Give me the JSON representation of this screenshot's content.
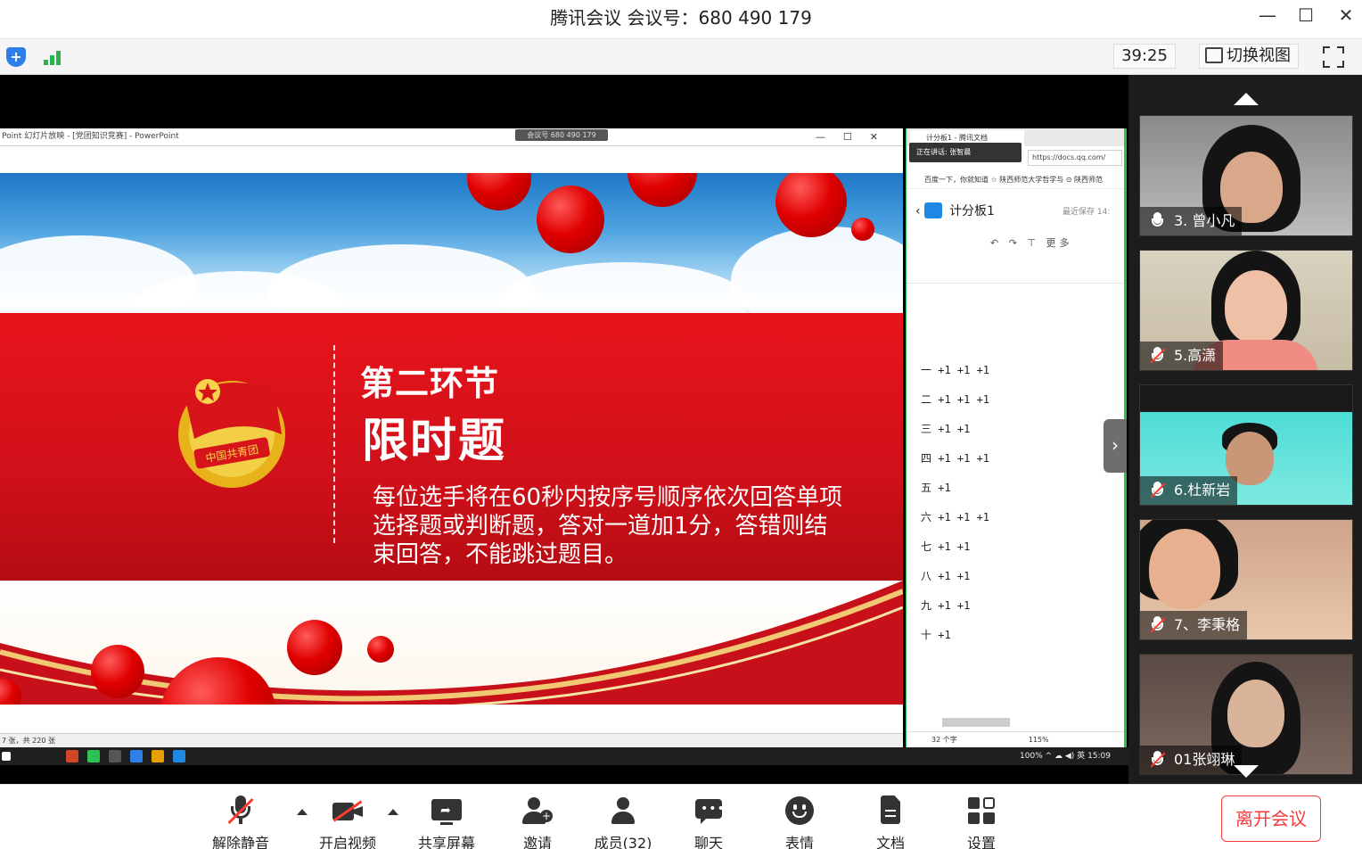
{
  "window": {
    "title": "腾讯会议 会议号：680 490 179",
    "controls": [
      "—",
      "☐",
      "✕"
    ]
  },
  "toolbar": {
    "timer": "39:25",
    "switch_view": "切换视图"
  },
  "share": {
    "ppt": {
      "window_title": "Point 幻灯片放映 - [党团知识竞赛] - PowerPoint",
      "meeting_badge": "会议号 680 490 179",
      "slide_status": "7 张，共 220 张",
      "slide": {
        "section": "第二环节",
        "subsection": "限时题",
        "description": "每位选手将在60秒内按序号顺序依次回答单项选择题或判断题，答对一道加1分，答错则结束回答，不能跳过题目。"
      }
    },
    "docs": {
      "tab_title": "计分板1 - 腾讯文档",
      "speaking": "正在讲话: 张智晨",
      "address": "https://docs.qq.com/",
      "bookmarks": "百度一下，你就知道   ☆ 陕西师范大学哲学与   ⊙ 陕西师范",
      "doc_title": "计分板1",
      "saved": "最近保存 14:",
      "tools_more": "更多",
      "lines": [
        "一  +1 +1 +1",
        "二 +1 +1 +1",
        "三 +1 +1",
        "四  +1 +1 +1",
        "五 +1",
        "六 +1 +1 +1",
        "七 +1 +1",
        "八 +1 +1",
        "九 +1 +1",
        "十 +1"
      ],
      "word_count": "32 个字",
      "zoom": "115%"
    },
    "taskbar": {
      "battery": "100%",
      "ime": "英",
      "clock": "15:09"
    }
  },
  "participants": [
    {
      "name": "3. 曾小凡",
      "muted": false
    },
    {
      "name": "5.高潇",
      "muted": true
    },
    {
      "name": "6.杜新岩",
      "muted": true
    },
    {
      "name": "7、李秉格",
      "muted": true
    },
    {
      "name": "01张翊琳",
      "muted": true
    }
  ],
  "controls": {
    "unmute": "解除静音",
    "video": "开启视频",
    "share": "共享屏幕",
    "invite": "邀请",
    "members": "成员(32)",
    "chat": "聊天",
    "reactions": "表情",
    "docs": "文档",
    "settings": "设置",
    "leave": "离开会议"
  },
  "colors": {
    "accent_red": "#f23c3c",
    "share_border": "#2bc252",
    "slide_red": "#e8141b"
  }
}
